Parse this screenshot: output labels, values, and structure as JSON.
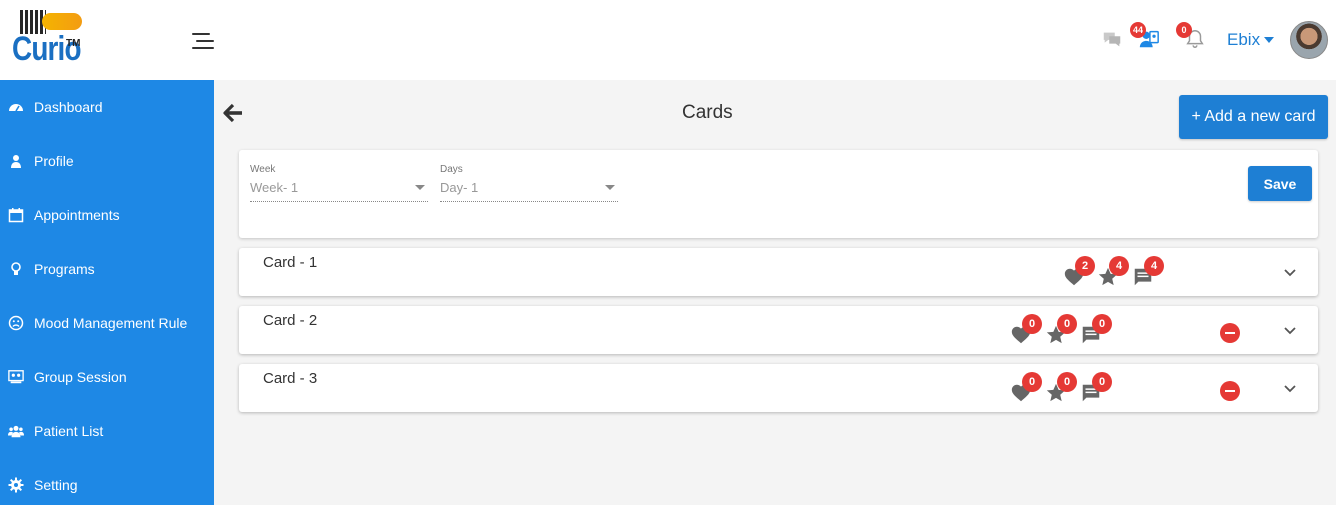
{
  "app": {
    "logo_text": "Curio",
    "logo_tm": "TM"
  },
  "header": {
    "users_badge": "44",
    "bell_badge": "0",
    "user_name": "Ebix"
  },
  "sidebar": {
    "items": [
      {
        "label": "Dashboard",
        "icon": "dashboard-icon"
      },
      {
        "label": "Profile",
        "icon": "user-icon"
      },
      {
        "label": "Appointments",
        "icon": "calendar-icon"
      },
      {
        "label": "Programs",
        "icon": "lightbulb-icon"
      },
      {
        "label": "Mood Management Rule",
        "icon": "frown-icon"
      },
      {
        "label": "Group Session",
        "icon": "group-session-icon"
      },
      {
        "label": "Patient List",
        "icon": "users-icon"
      },
      {
        "label": "Setting",
        "icon": "gear-icon"
      }
    ]
  },
  "main": {
    "title": "Cards",
    "add_button": "+ Add a new card",
    "filters": {
      "week_label": "Week",
      "week_value": "Week- 1",
      "days_label": "Days",
      "days_value": "Day- 1",
      "save_label": "Save"
    },
    "cards": [
      {
        "name": "Card - 1",
        "likes": "2",
        "stars": "4",
        "comments": "4",
        "removable": false
      },
      {
        "name": "Card - 2",
        "likes": "0",
        "stars": "0",
        "comments": "0",
        "removable": true
      },
      {
        "name": "Card - 3",
        "likes": "0",
        "stars": "0",
        "comments": "0",
        "removable": true
      }
    ]
  },
  "colors": {
    "primary": "#1e88e5",
    "button": "#1e7fd4",
    "badge": "#e53935"
  }
}
